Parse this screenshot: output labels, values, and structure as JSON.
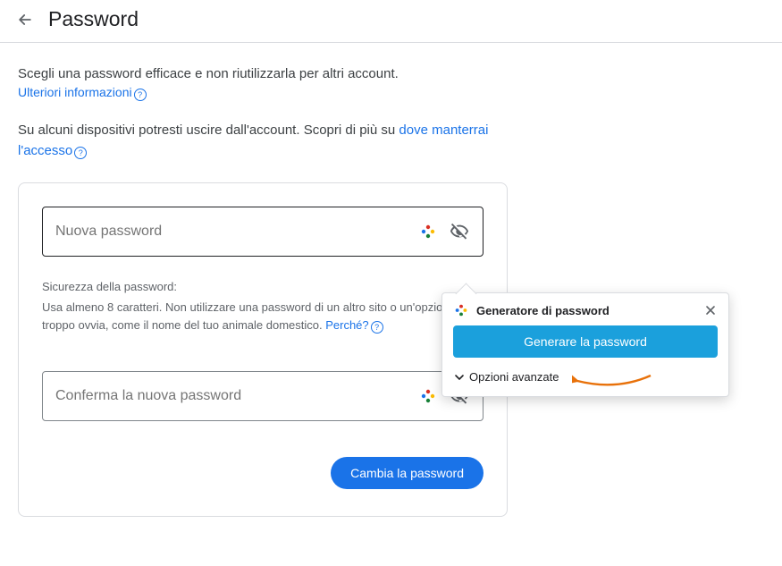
{
  "header": {
    "title": "Password"
  },
  "intro": {
    "line1": "Scegli una password efficace e non riutilizzarla per altri account.",
    "learnMore": "Ulteriori informazioni"
  },
  "para2": {
    "before": "Su alcuni dispositivi potresti uscire dall'account. Scopri di più su ",
    "link": "dove manterrai l'accesso"
  },
  "fields": {
    "newPassword": {
      "placeholder": "Nuova password"
    },
    "confirmPassword": {
      "placeholder": "Conferma la nuova password"
    }
  },
  "strength": {
    "label": "Sicurezza della password:",
    "desc_before": "Usa almeno 8 caratteri. Non utilizzare una password di un altro sito o un'opzione troppo ovvia, come il nome del tuo animale domestico. ",
    "why": "Perché?"
  },
  "actions": {
    "change": "Cambia la password"
  },
  "popup": {
    "title": "Generatore di password",
    "generate": "Generare la password",
    "advanced": "Opzioni avanzate"
  }
}
